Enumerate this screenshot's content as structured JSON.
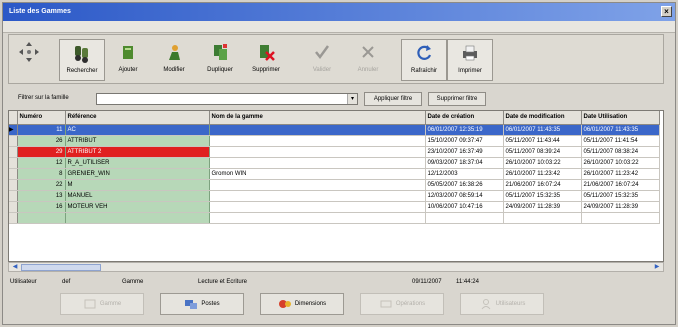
{
  "window": {
    "title": "Liste des Gammes",
    "close_glyph": "×"
  },
  "toolbar": {
    "buttons": [
      {
        "id": "nav",
        "label": "",
        "icon": "four-arrows-icon"
      },
      {
        "id": "rechercher",
        "label": "Rechercher",
        "icon": "search-binoculars-icon"
      },
      {
        "id": "ajouter",
        "label": "Ajouter",
        "icon": "add-document-icon"
      },
      {
        "id": "modifier",
        "label": "Modifier",
        "icon": "edit-person-icon"
      },
      {
        "id": "dupliquer",
        "label": "Dupliquer",
        "icon": "duplicate-icon"
      },
      {
        "id": "supprimer",
        "label": "Supprimer",
        "icon": "delete-icon"
      },
      {
        "id": "valider",
        "label": "Valider",
        "icon": "check-icon"
      },
      {
        "id": "annuler",
        "label": "Annuler",
        "icon": "cancel-x-icon"
      },
      {
        "id": "rafraichir",
        "label": "Rafraîchir",
        "icon": "refresh-icon"
      },
      {
        "id": "imprimer",
        "label": "Imprimer",
        "icon": "printer-icon"
      }
    ]
  },
  "filter": {
    "label": "Filtrer sur la famille",
    "value": "",
    "apply_label": "Appliquer filtre",
    "remove_label": "Supprimer filtre"
  },
  "grid": {
    "columns": [
      "Numéro",
      "Référence",
      "Nom de la gamme",
      "Date de création",
      "Date de modification",
      "Date Utilisation"
    ],
    "rows": [
      {
        "num": "11",
        "ref": "AC",
        "nom": "",
        "creation": "06/01/2007 12:35:19",
        "modif": "06/01/2007 11:43:35",
        "util": "06/01/2007 11:43:35",
        "state": "selected"
      },
      {
        "num": "26",
        "ref": "ATTRIBUT",
        "nom": "",
        "creation": "15/10/2007 09:37:47",
        "modif": "05/11/2007 11:43:44",
        "util": "05/11/2007 11:41:54",
        "state": "normal"
      },
      {
        "num": "29",
        "ref": "ATTRIBUT 2",
        "nom": "",
        "creation": "23/10/2007 16:37:49",
        "modif": "05/11/2007 08:39:24",
        "util": "05/11/2007 08:38:24",
        "state": "red"
      },
      {
        "num": "12",
        "ref": "R_A_UTILISER",
        "nom": "",
        "creation": "09/03/2007 18:37:04",
        "modif": "26/10/2007 10:03:22",
        "util": "26/10/2007 10:03:22",
        "state": "normal"
      },
      {
        "num": "8",
        "ref": "GRENIER_WIN",
        "nom": "Gromon WIN",
        "creation": "12/12/2003",
        "modif": "26/10/2007 11:23:42",
        "util": "26/10/2007 11:23:42",
        "state": "normal"
      },
      {
        "num": "22",
        "ref": "M",
        "nom": "",
        "creation": "05/05/2007 16:38:26",
        "modif": "21/06/2007 16:07:24",
        "util": "21/06/2007 16:07:24",
        "state": "normal"
      },
      {
        "num": "13",
        "ref": "MANUEL",
        "nom": "",
        "creation": "12/03/2007 08:59:14",
        "modif": "05/11/2007 15:32:35",
        "util": "05/11/2007 15:32:35",
        "state": "normal"
      },
      {
        "num": "16",
        "ref": "MOTEUR VEH",
        "nom": "",
        "creation": "10/06/2007 10:47:16",
        "modif": "24/09/2007 11:28:39",
        "util": "24/09/2007 11:28:39",
        "state": "normal"
      }
    ]
  },
  "status": {
    "user_label": "Utilisateur",
    "user_value": "def",
    "module": "Gamme",
    "mode": "Lecture et Ecriture",
    "date": "09/11/2007",
    "time": "11:44:24"
  },
  "bottom": {
    "buttons": [
      {
        "label": "Gamme",
        "icon": "gamme-icon",
        "enabled": false
      },
      {
        "label": "Postes",
        "icon": "postes-icon",
        "enabled": true
      },
      {
        "label": "Dimensions",
        "icon": "dimensions-icon",
        "enabled": true
      },
      {
        "label": "Opérations",
        "icon": "operations-icon",
        "enabled": false
      },
      {
        "label": "Utilisateurs",
        "icon": "utilisateurs-icon",
        "enabled": false
      }
    ]
  },
  "colors": {
    "title_bar": "#2b58c7",
    "selected_row": "#3b67c9",
    "green_cell": "#b7d8b8",
    "red_cell": "#e02020"
  }
}
